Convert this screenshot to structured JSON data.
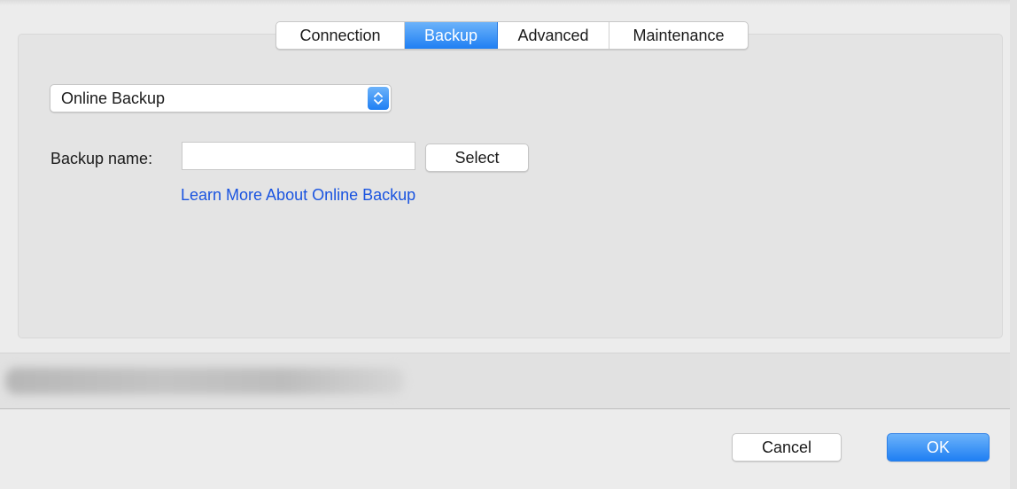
{
  "tabs": [
    {
      "label": "Connection",
      "active": false
    },
    {
      "label": "Backup",
      "active": true
    },
    {
      "label": "Advanced",
      "active": false
    },
    {
      "label": "Maintenance",
      "active": false
    }
  ],
  "backup_type": {
    "selected": "Online Backup"
  },
  "backup_name": {
    "label": "Backup name:",
    "value": "",
    "select_button": "Select"
  },
  "learn_more_link": "Learn More About Online Backup",
  "footer": {
    "cancel_label": "Cancel",
    "ok_label": "OK"
  },
  "colors": {
    "accent": "#1f7ff3",
    "link": "#1a54e0"
  }
}
